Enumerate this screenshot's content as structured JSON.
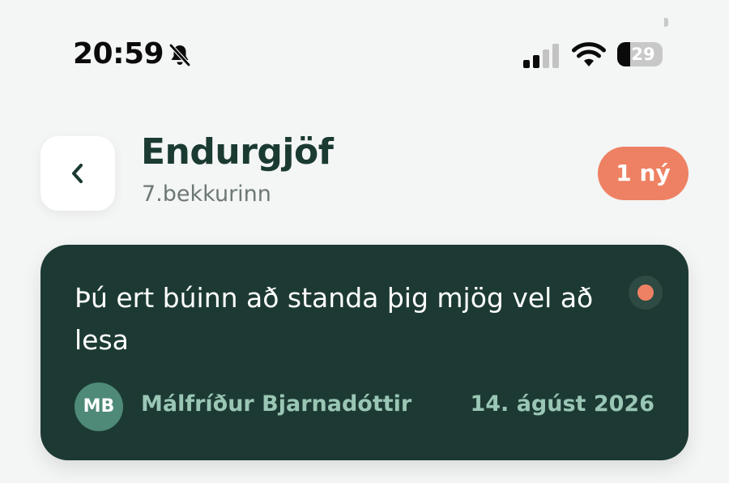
{
  "status_bar": {
    "time": "20:59",
    "battery": "29",
    "battery_level": 0.29,
    "icons": [
      "bell-slash-icon",
      "cellular-signal-icon",
      "wifi-icon",
      "battery-icon"
    ]
  },
  "header": {
    "back_icon": "chevron-left-icon",
    "title": "Endurgjöf",
    "subtitle": "7.bekkurinn",
    "badge": "1 ný"
  },
  "feedback": [
    {
      "message": "Þú ert búinn að standa þig mjög vel að lesa",
      "author_initials": "MB",
      "author_name": "Málfríður Bjarnadóttir",
      "date": "14. ágúst 2026",
      "unread": true
    }
  ],
  "colors": {
    "background": "#f4f5f5",
    "primary_dark": "#1c3a33",
    "title_text": "#1a3a32",
    "accent": "#ee8163",
    "avatar": "#4f8a78",
    "muted_green": "#9ac6b5"
  }
}
